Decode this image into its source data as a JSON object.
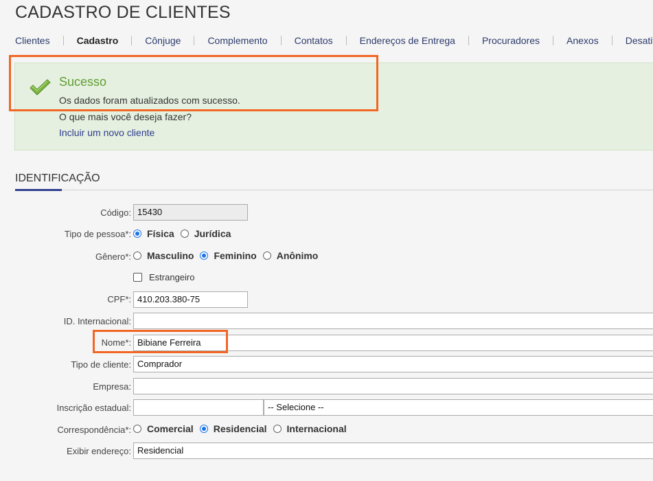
{
  "page": {
    "title": "CADASTRO DE CLIENTES"
  },
  "tabs": [
    {
      "label": "Clientes"
    },
    {
      "label": "Cadastro",
      "active": true
    },
    {
      "label": "Cônjuge"
    },
    {
      "label": "Complemento"
    },
    {
      "label": "Contatos"
    },
    {
      "label": "Endereços de Entrega"
    },
    {
      "label": "Procuradores"
    },
    {
      "label": "Anexos"
    },
    {
      "label": "Desativar"
    }
  ],
  "alert": {
    "title": "Sucesso",
    "message": "Os dados foram atualizados com sucesso.",
    "question": "O que mais você deseja fazer?",
    "link": "Incluir um novo cliente",
    "icon": "checkmark-icon",
    "color": "#5f9e31"
  },
  "section": {
    "title": "IDENTIFICAÇÃO",
    "accent_color": "#2e3f8f"
  },
  "form": {
    "codigo": {
      "label": "Código:",
      "value": "15430"
    },
    "tipo_pessoa": {
      "label": "Tipo de pessoa*:",
      "options": [
        "Física",
        "Jurídica"
      ],
      "selected": "Física"
    },
    "genero": {
      "label": "Gênero*:",
      "options": [
        "Masculino",
        "Feminino",
        "Anônimo"
      ],
      "selected": "Feminino"
    },
    "estrangeiro": {
      "label": "Estrangeiro",
      "checked": false
    },
    "cpf": {
      "label": "CPF*:",
      "value": "410.203.380-75"
    },
    "id_internacional": {
      "label": "ID. Internacional:",
      "value": ""
    },
    "nome": {
      "label": "Nome*:",
      "value": "Bibiane Ferreira"
    },
    "tipo_cliente": {
      "label": "Tipo de cliente:",
      "value": "Comprador"
    },
    "empresa": {
      "label": "Empresa:",
      "value": ""
    },
    "inscricao_estadual": {
      "label": "Inscrição estadual:",
      "value": "",
      "select_value": "-- Selecione --"
    },
    "correspondencia": {
      "label": "Correspondência*:",
      "options": [
        "Comercial",
        "Residencial",
        "Internacional"
      ],
      "selected": "Residencial"
    },
    "exibir_endereco": {
      "label": "Exibir endereço:",
      "value": "Residencial"
    }
  },
  "highlight_color": "#f26522"
}
